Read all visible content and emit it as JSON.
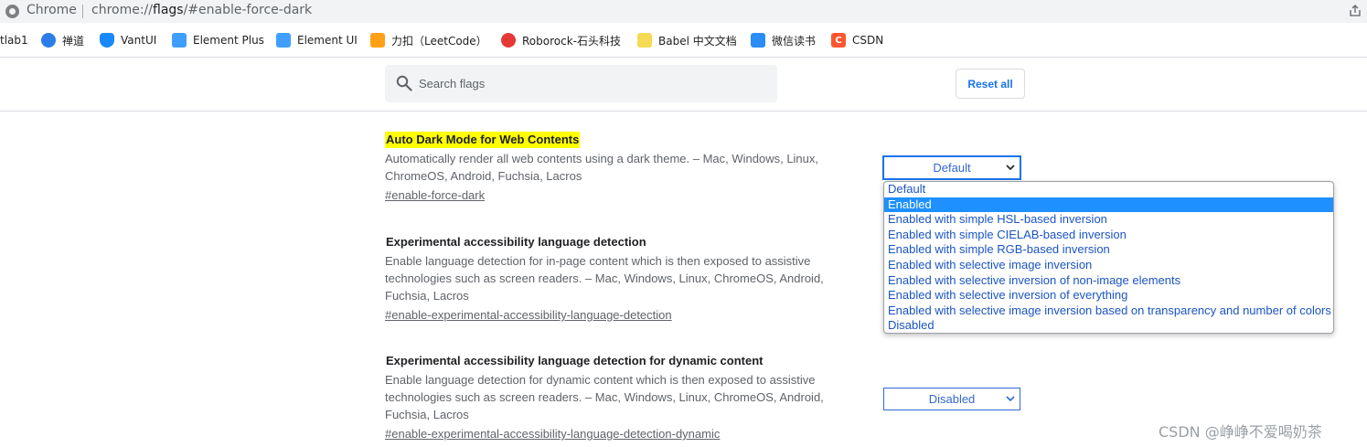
{
  "omnibox": {
    "browser_label": "Chrome",
    "url_prefix": "chrome://",
    "url_strong": "flags",
    "url_suffix": "/#enable-force-dark"
  },
  "bookmarks": [
    {
      "label": "tlab1",
      "icon": "none"
    },
    {
      "label": "禅道",
      "icon": "zentao-icon",
      "color": "#2b7de9"
    },
    {
      "label": "VantUI",
      "icon": "vant-icon",
      "color": "#1989fa"
    },
    {
      "label": "Element Plus",
      "icon": "element-plus-icon",
      "color": "#409eff"
    },
    {
      "label": "Element UI",
      "icon": "element-ui-icon",
      "color": "#409eff"
    },
    {
      "label": "力扣（LeetCode）",
      "icon": "leetcode-icon",
      "color": "#ffa116"
    },
    {
      "label": "Roborock-石头科技",
      "icon": "roborock-icon",
      "color": "#e53935"
    },
    {
      "label": "Babel 中文文档",
      "icon": "babel-icon",
      "color": "#f5da55"
    },
    {
      "label": "微信读书",
      "icon": "weread-icon",
      "color": "#2a8cf5"
    },
    {
      "label": "CSDN",
      "icon": "csdn-icon",
      "color": "#fc5531",
      "glyph": "C"
    }
  ],
  "toolbar": {
    "search_placeholder": "Search flags",
    "reset_label": "Reset all"
  },
  "experiments": [
    {
      "title": "Auto Dark Mode for Web Contents",
      "description": "Automatically render all web contents using a dark theme. – Mac, Windows, Linux, ChromeOS, Android, Fuchsia, Lacros",
      "link": "#enable-force-dark",
      "select_value": "Default"
    },
    {
      "title": "Experimental accessibility language detection",
      "description": "Enable language detection for in-page content which is then exposed to assistive technologies such as screen readers. – Mac, Windows, Linux, ChromeOS, Android, Fuchsia, Lacros",
      "link": "#enable-experimental-accessibility-language-detection"
    },
    {
      "title": "Experimental accessibility language detection for dynamic content",
      "description": "Enable language detection for dynamic content which is then exposed to assistive technologies such as screen readers. – Mac, Windows, Linux, ChromeOS, Android, Fuchsia, Lacros",
      "link": "#enable-experimental-accessibility-language-detection-dynamic",
      "select_value": "Disabled"
    }
  ],
  "dropdown": {
    "options": [
      "Default",
      "Enabled",
      "Enabled with simple HSL-based inversion",
      "Enabled with simple CIELAB-based inversion",
      "Enabled with simple RGB-based inversion",
      "Enabled with selective image inversion",
      "Enabled with selective inversion of non-image elements",
      "Enabled with selective inversion of everything",
      "Enabled with selective image inversion based on transparency and number of colors",
      "Disabled"
    ],
    "highlighted": "Enabled"
  },
  "watermark": "CSDN @峥峥不爱喝奶茶",
  "colors": {
    "accent": "#1a73e8",
    "highlight": "#ffff00",
    "option_selected_bg": "#1e90ff"
  }
}
